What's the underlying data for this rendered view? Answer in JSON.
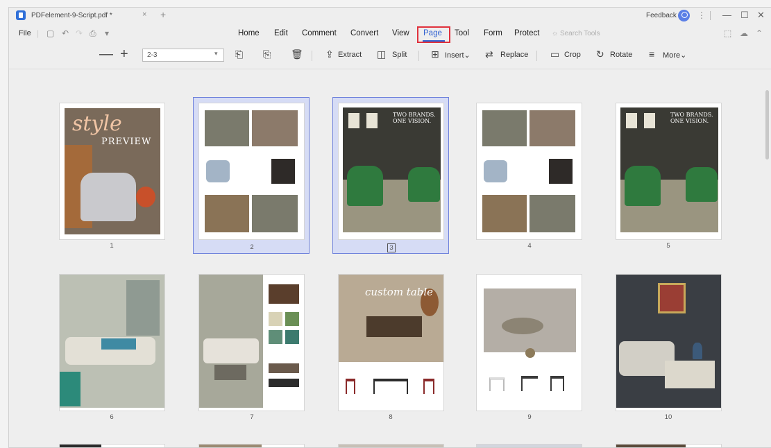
{
  "titlebar": {
    "tab_title": "PDFelement-9-Script.pdf *",
    "tab_close": "×",
    "tab_add": "+",
    "feedback": "Feedback",
    "kebab": "⋮",
    "minimize": "—",
    "maximize": "☐",
    "close": "✕"
  },
  "menu": {
    "file": "File",
    "items": [
      "Home",
      "Edit",
      "Comment",
      "Convert",
      "View",
      "Page",
      "Tool",
      "Form",
      "Protect"
    ],
    "active": "Page",
    "search_placeholder": "Search Tools"
  },
  "toolbar": {
    "zoom_out": "—",
    "zoom_in": "+",
    "page_range": "2-3",
    "extract": "Extract",
    "split": "Split",
    "insert": "Insert",
    "replace": "Replace",
    "crop": "Crop",
    "rotate": "Rotate",
    "more": "More"
  },
  "pages": [
    {
      "num": "1",
      "selected": false
    },
    {
      "num": "2",
      "selected": true
    },
    {
      "num": "3",
      "selected": true
    },
    {
      "num": "4",
      "selected": false
    },
    {
      "num": "5",
      "selected": false
    },
    {
      "num": "6",
      "selected": false
    },
    {
      "num": "7",
      "selected": false
    },
    {
      "num": "8",
      "selected": false
    },
    {
      "num": "9",
      "selected": false
    },
    {
      "num": "10",
      "selected": false
    }
  ],
  "thumb_text": {
    "p1_title": "style",
    "p1_subtitle": "PREVIEW",
    "p3_headline": "TWO BRANDS. ONE VISION.",
    "p5_headline": "TWO BRANDS. ONE VISION.",
    "p8_title": "custom table"
  },
  "colors": {
    "accent": "#2f5fd0",
    "highlight_box": "#e0313c",
    "selection_fill": "#d6dcf5",
    "selection_border": "#6f82dc",
    "brand_logo": "#2f6fd8"
  }
}
